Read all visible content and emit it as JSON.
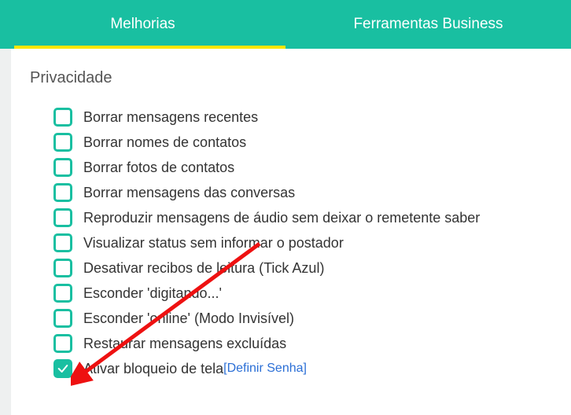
{
  "tabs": {
    "improvements": "Melhorias",
    "business": "Ferramentas Business"
  },
  "section": {
    "title": "Privacidade"
  },
  "options": [
    {
      "label": "Borrar mensagens recentes",
      "checked": false
    },
    {
      "label": "Borrar nomes de contatos",
      "checked": false
    },
    {
      "label": "Borrar fotos de contatos",
      "checked": false
    },
    {
      "label": "Borrar mensagens das conversas",
      "checked": false
    },
    {
      "label": "Reproduzir mensagens de áudio sem deixar o remetente saber",
      "checked": false
    },
    {
      "label": "Visualizar status sem informar o postador",
      "checked": false
    },
    {
      "label": "Desativar recibos de leitura (Tick Azul)",
      "checked": false
    },
    {
      "label": "Esconder 'digitando...'",
      "checked": false
    },
    {
      "label": "Esconder 'online' (Modo Invisível)",
      "checked": false
    },
    {
      "label": "Restaurar mensagens excluídas",
      "checked": false
    },
    {
      "label": "Ativar bloqueio de tela",
      "checked": true,
      "link": "[Definir Senha]"
    }
  ]
}
